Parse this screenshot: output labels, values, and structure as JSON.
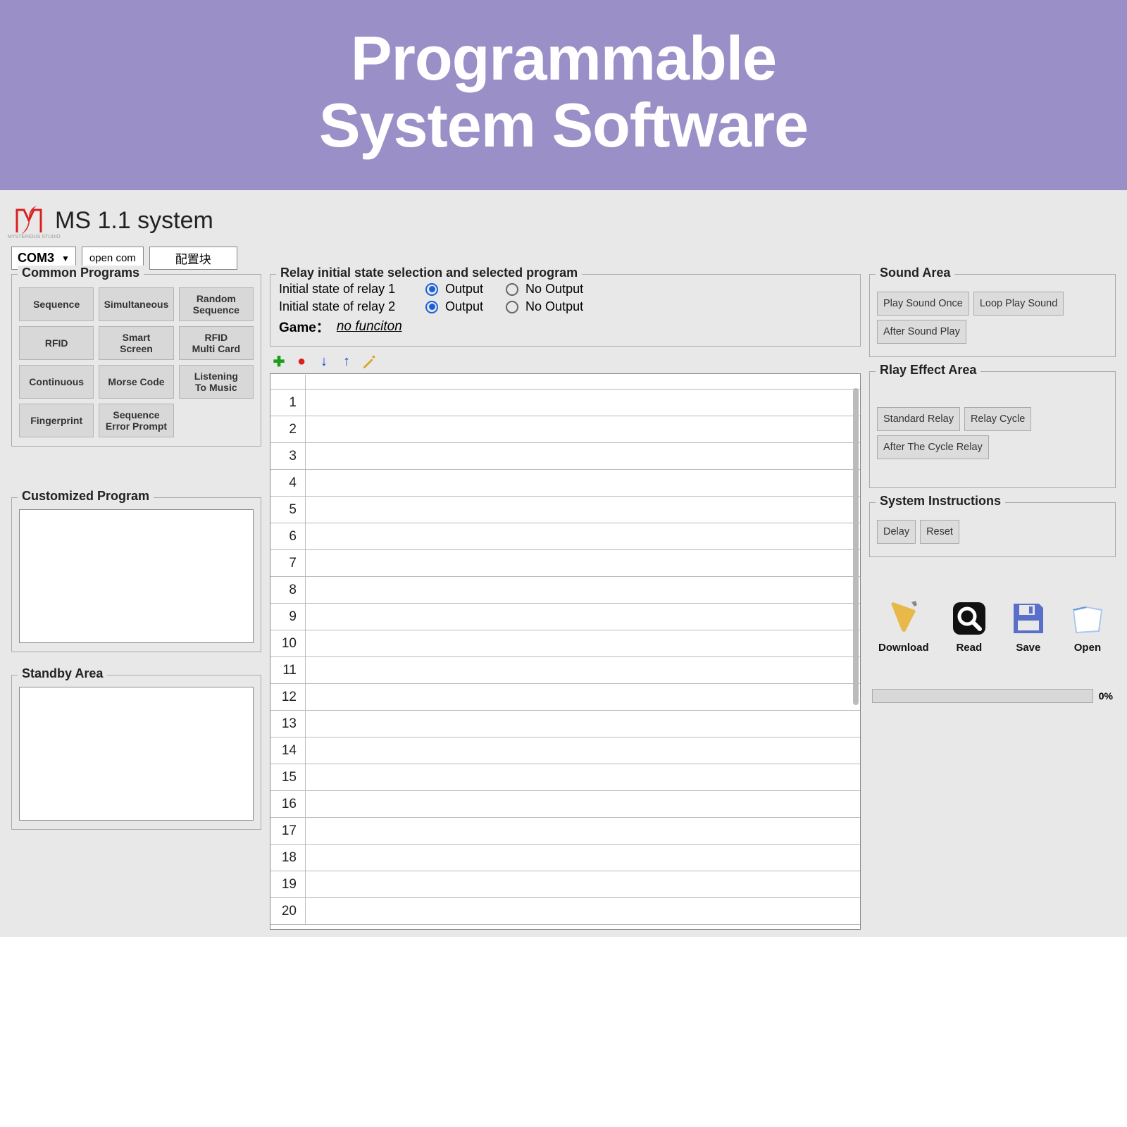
{
  "banner": {
    "line1": "Programmable",
    "line2": "System Software"
  },
  "header": {
    "logo_sub": "MYSTERIOUS STUDIO",
    "app_title": "MS 1.1 system"
  },
  "toolbar": {
    "com": "COM3",
    "open_com": "open com",
    "config": "配置块"
  },
  "commonPrograms": {
    "title": "Common Programs",
    "items": [
      "Sequence",
      "Simultaneous",
      "Random\nSequence",
      "RFID",
      "Smart\nScreen",
      "RFID\nMulti Card",
      "Continuous",
      "Morse Code",
      "Listening\nTo Music",
      "Fingerprint",
      "Sequence\nError Prompt"
    ]
  },
  "customized": {
    "title": "Customized Program"
  },
  "standby": {
    "title": "Standby Area"
  },
  "relay": {
    "title": "Relay initial state selection and selected program",
    "row1_label": "Initial state of relay 1",
    "row2_label": "Initial state of relay 2",
    "opt_output": "Output",
    "opt_no_output": "No Output",
    "relay1_state": "Output",
    "relay2_state": "Output",
    "game_label": "Game：",
    "game_value": "no funciton"
  },
  "listToolbar": {
    "add": "+",
    "remove": "−",
    "down": "↓",
    "up": "↑",
    "wand": "wand"
  },
  "listRows": [
    1,
    2,
    3,
    4,
    5,
    6,
    7,
    8,
    9,
    10,
    11,
    12,
    13,
    14,
    15,
    16,
    17,
    18,
    19,
    20
  ],
  "soundArea": {
    "title": "Sound Area",
    "buttons": [
      "Play Sound Once",
      "Loop Play Sound",
      "After Sound Play"
    ]
  },
  "relayEffect": {
    "title": "Rlay Effect Area",
    "buttons": [
      "Standard Relay",
      "Relay Cycle",
      "After The Cycle Relay"
    ]
  },
  "sysInstr": {
    "title": "System Instructions",
    "buttons": [
      "Delay",
      "Reset"
    ]
  },
  "fileOps": {
    "download": "Download",
    "read": "Read",
    "save": "Save",
    "open": "Open"
  },
  "progress": {
    "pct": "0%"
  }
}
